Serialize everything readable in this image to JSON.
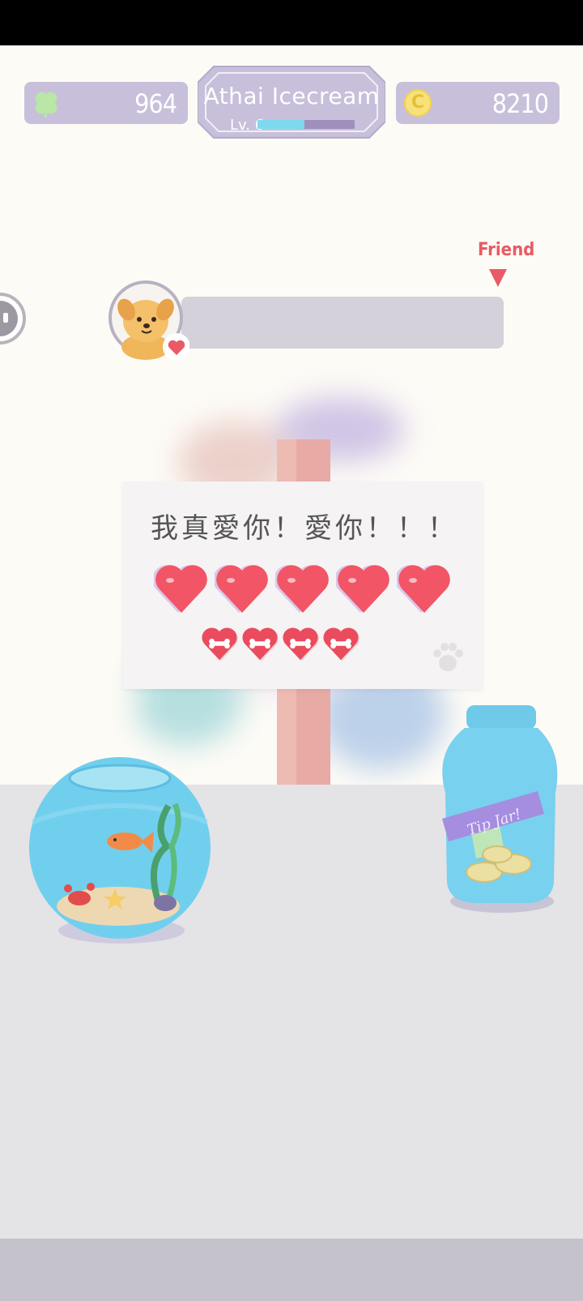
{
  "hud": {
    "clovers": "964",
    "coins": "8210",
    "coin_symbol": "C",
    "player_name": "Athai Icecream",
    "level_label": "Lv. 6",
    "xp_fraction": 0.48
  },
  "friend": {
    "label": "Friend"
  },
  "sign": {
    "message": "我真愛你！愛你！！！",
    "big_hearts": 5,
    "small_hearts": 4
  },
  "jar": {
    "label": "Tip Jar!"
  },
  "colors": {
    "hud_panel": "#c8c0da",
    "accent_red": "#e85a66",
    "heart_red": "#f25566",
    "xp_fill": "#7ed9ee"
  },
  "icons": [
    "clover-icon",
    "coin-icon",
    "heart-icon",
    "paw-icon",
    "chat-icon"
  ]
}
